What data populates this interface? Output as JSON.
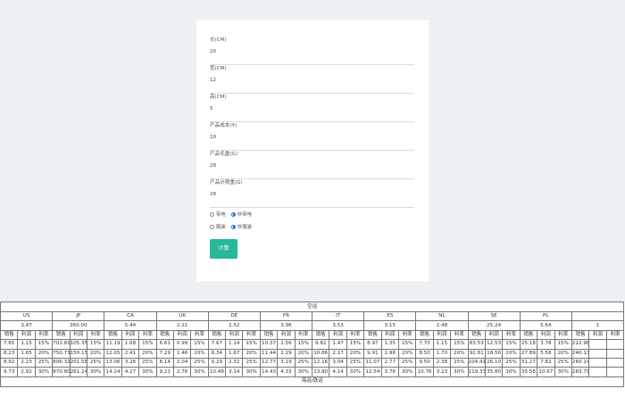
{
  "form": {
    "fields": [
      {
        "label": "长(CM)",
        "value": "20"
      },
      {
        "label": "宽(CM)",
        "value": "12"
      },
      {
        "label": "高(CM)",
        "value": "5"
      },
      {
        "label": "产品成本(¥)",
        "value": "10"
      },
      {
        "label": "产品毛重(G)",
        "value": "28"
      },
      {
        "label": "产品计费重(G)",
        "value": "28"
      }
    ],
    "radio_groups": [
      {
        "options": [
          {
            "label": "带电",
            "selected": false
          },
          {
            "label": "非带电",
            "selected": true
          }
        ]
      },
      {
        "options": [
          {
            "label": "服装",
            "selected": false
          },
          {
            "label": "非服装",
            "selected": true
          }
        ]
      }
    ],
    "submit_label": "计算"
  },
  "table": {
    "title": "空运",
    "footer": "海运/铁运",
    "countries": [
      {
        "code": "US",
        "rate": "3.47",
        "rows": [
          {
            "sale": "7.65",
            "profit": "1.15",
            "margin": "15%"
          },
          {
            "sale": "8.23",
            "profit": "1.65",
            "margin": "20%"
          },
          {
            "sale": "8.92",
            "profit": "2.23",
            "margin": "25%"
          },
          {
            "sale": "9.73",
            "profit": "2.92",
            "margin": "30%"
          }
        ]
      },
      {
        "code": "JP",
        "rate": "360.00",
        "rows": [
          {
            "sale": "702.81",
            "profit": "105.35",
            "margin": "15%"
          },
          {
            "sale": "750.73",
            "profit": "150.15",
            "margin": "20%"
          },
          {
            "sale": "806.32",
            "profit": "201.58",
            "margin": "25%"
          },
          {
            "sale": "870.80",
            "profit": "261.24",
            "margin": "30%"
          }
        ]
      },
      {
        "code": "CA",
        "rate": "5.44",
        "rows": [
          {
            "sale": "11.19",
            "profit": "1.68",
            "margin": "15%"
          },
          {
            "sale": "12.05",
            "profit": "2.41",
            "margin": "20%"
          },
          {
            "sale": "13.06",
            "profit": "3.26",
            "margin": "25%"
          },
          {
            "sale": "14.24",
            "profit": "4.27",
            "margin": "30%"
          }
        ]
      },
      {
        "code": "UK",
        "rate": "2.21",
        "rows": [
          {
            "sale": "6.61",
            "profit": "0.99",
            "margin": "15%"
          },
          {
            "sale": "7.29",
            "profit": "1.46",
            "margin": "20%"
          },
          {
            "sale": "8.14",
            "profit": "2.04",
            "margin": "25%"
          },
          {
            "sale": "9.21",
            "profit": "2.76",
            "margin": "30%"
          }
        ]
      },
      {
        "code": "DE",
        "rate": "2.52",
        "rows": [
          {
            "sale": "7.67",
            "profit": "1.14",
            "margin": "15%"
          },
          {
            "sale": "8.34",
            "profit": "1.67",
            "margin": "20%"
          },
          {
            "sale": "9.29",
            "profit": "2.32",
            "margin": "25%"
          },
          {
            "sale": "10.48",
            "profit": "3.14",
            "margin": "30%"
          }
        ]
      },
      {
        "code": "FR",
        "rate": "3.96",
        "rows": [
          {
            "sale": "10.37",
            "profit": "1.56",
            "margin": "15%"
          },
          {
            "sale": "11.44",
            "profit": "2.29",
            "margin": "20%"
          },
          {
            "sale": "12.77",
            "profit": "3.19",
            "margin": "25%"
          },
          {
            "sale": "14.43",
            "profit": "4.33",
            "margin": "30%"
          }
        ]
      },
      {
        "code": "IT",
        "rate": "3.53",
        "rows": [
          {
            "sale": "9.82",
            "profit": "1.47",
            "margin": "15%"
          },
          {
            "sale": "10.86",
            "profit": "2.17",
            "margin": "20%"
          },
          {
            "sale": "12.16",
            "profit": "3.04",
            "margin": "25%"
          },
          {
            "sale": "13.80",
            "profit": "4.14",
            "margin": "30%"
          }
        ]
      },
      {
        "code": "ES",
        "rate": "3.15",
        "rows": [
          {
            "sale": "8.97",
            "profit": "1.35",
            "margin": "15%"
          },
          {
            "sale": "9.91",
            "profit": "1.98",
            "margin": "20%"
          },
          {
            "sale": "11.07",
            "profit": "2.77",
            "margin": "25%"
          },
          {
            "sale": "12.54",
            "profit": "3.76",
            "margin": "30%"
          }
        ]
      },
      {
        "code": "NL",
        "rate": "2.48",
        "rows": [
          {
            "sale": "7.70",
            "profit": "1.15",
            "margin": "15%"
          },
          {
            "sale": "8.50",
            "profit": "1.70",
            "margin": "20%"
          },
          {
            "sale": "9.50",
            "profit": "2.38",
            "margin": "25%"
          },
          {
            "sale": "10.76",
            "profit": "3.23",
            "margin": "30%"
          }
        ]
      },
      {
        "code": "SE",
        "rate": "25.24",
        "rows": [
          {
            "sale": "83.53",
            "profit": "12.53",
            "margin": "15%"
          },
          {
            "sale": "92.81",
            "profit": "18.56",
            "margin": "20%"
          },
          {
            "sale": "104.41",
            "profit": "26.10",
            "margin": "25%"
          },
          {
            "sale": "119.33",
            "profit": "35.80",
            "margin": "30%"
          }
        ]
      },
      {
        "code": "PL",
        "rate": "5.64",
        "rows": [
          {
            "sale": "25.18",
            "profit": "3.78",
            "margin": "15%"
          },
          {
            "sale": "27.89",
            "profit": "5.58",
            "margin": "20%"
          },
          {
            "sale": "31.27",
            "profit": "7.82",
            "margin": "25%"
          },
          {
            "sale": "35.58",
            "profit": "10.67",
            "margin": "30%"
          }
        ]
      },
      {
        "code": "",
        "rate": "1",
        "rows": [
          {
            "sale": "222.98",
            "profit": "",
            "margin": ""
          },
          {
            "sale": "240.13",
            "profit": "",
            "margin": ""
          },
          {
            "sale": "260.14",
            "profit": "",
            "margin": ""
          },
          {
            "sale": "283.79",
            "profit": "",
            "margin": ""
          }
        ]
      }
    ],
    "col_headers": {
      "sale": "销售",
      "profit": "利润",
      "margin": "利率"
    }
  }
}
